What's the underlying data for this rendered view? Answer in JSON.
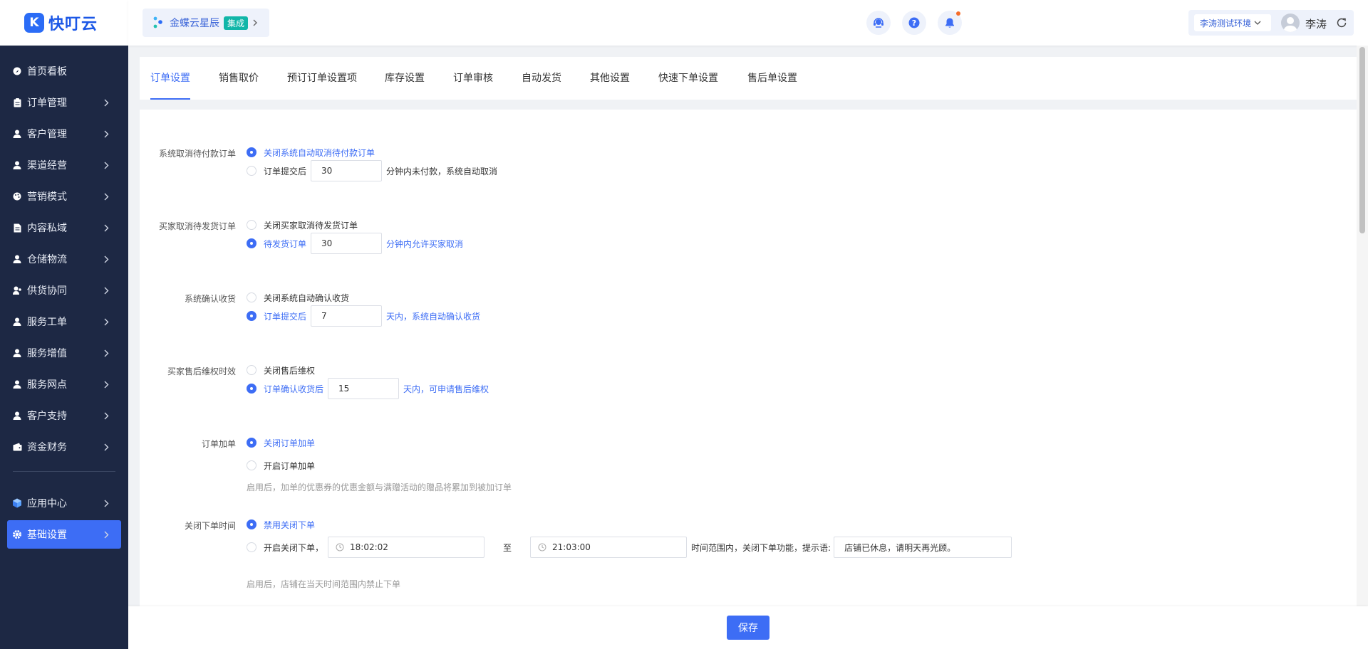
{
  "app": {
    "logo_glyph": "K",
    "logo_text": "快叮云",
    "brand_color": "#2b6cf6"
  },
  "header": {
    "brand_name": "金蝶云星辰",
    "brand_tag": "集成",
    "env_label": "李涛测试环境",
    "user_name": "李涛"
  },
  "sidebar": {
    "items": [
      {
        "label": "首页看板",
        "icon": "dashboard-icon"
      },
      {
        "label": "订单管理",
        "icon": "clipboard-icon"
      },
      {
        "label": "客户管理",
        "icon": "user-icon"
      },
      {
        "label": "渠道经营",
        "icon": "user-icon"
      },
      {
        "label": "营销模式",
        "icon": "palette-icon"
      },
      {
        "label": "内容私域",
        "icon": "document-icon"
      },
      {
        "label": "仓储物流",
        "icon": "user-icon"
      },
      {
        "label": "供货协同",
        "icon": "user-group-icon"
      },
      {
        "label": "服务工单",
        "icon": "user-icon"
      },
      {
        "label": "服务增值",
        "icon": "user-icon"
      },
      {
        "label": "服务网点",
        "icon": "user-icon"
      },
      {
        "label": "客户支持",
        "icon": "user-icon"
      },
      {
        "label": "资金财务",
        "icon": "wallet-icon"
      }
    ],
    "bottom_items": [
      {
        "label": "应用中心",
        "icon": "cube-icon"
      },
      {
        "label": "基础设置",
        "icon": "gear-icon",
        "active": true
      }
    ]
  },
  "tabs": [
    "订单设置",
    "销售取价",
    "预订订单设置项",
    "库存设置",
    "订单审核",
    "自动发货",
    "其他设置",
    "快速下单设置",
    "售后单设置"
  ],
  "form": {
    "cancel_unpaid": {
      "label": "系统取消待付款订单",
      "opt1": "关闭系统自动取消待付款订单",
      "opt2_prefix": "订单提交后",
      "opt2_value": "30",
      "opt2_suffix": "分钟内未付款，系统自动取消"
    },
    "buyer_cancel": {
      "label": "买家取消待发货订单",
      "opt1": "关闭买家取消待发货订单",
      "opt2_prefix": "待发货订单",
      "opt2_value": "30",
      "opt2_suffix": "分钟内允许买家取消"
    },
    "confirm_receipt": {
      "label": "系统确认收货",
      "opt1": "关闭系统自动确认收货",
      "opt2_prefix": "订单提交后",
      "opt2_value": "7",
      "opt2_suffix": "天内，系统自动确认收货"
    },
    "after_sale": {
      "label": "买家售后维权时效",
      "opt1": "关闭售后维权",
      "opt2_prefix": "订单确认收货后",
      "opt2_value": "15",
      "opt2_suffix": "天内，可申请售后维权"
    },
    "add_order": {
      "label": "订单加单",
      "opt1": "关闭订单加单",
      "opt2": "开启订单加单",
      "hint": "启用后，加单的优惠券的优惠金额与满赠活动的赠品将累加到被加订单"
    },
    "close_time": {
      "label": "关闭下单时间",
      "opt1": "禁用关闭下单",
      "opt2_prefix": "开启关闭下单，",
      "start_time": "18:02:02",
      "to": "至",
      "end_time": "21:03:00",
      "opt2_suffix": "时间范围内，关闭下单功能，提示语:",
      "message": "店铺已休息，请明天再光顾。",
      "hint": "启用后，店铺在当天时间范围内禁止下单"
    }
  },
  "footer": {
    "save_label": "保存"
  }
}
